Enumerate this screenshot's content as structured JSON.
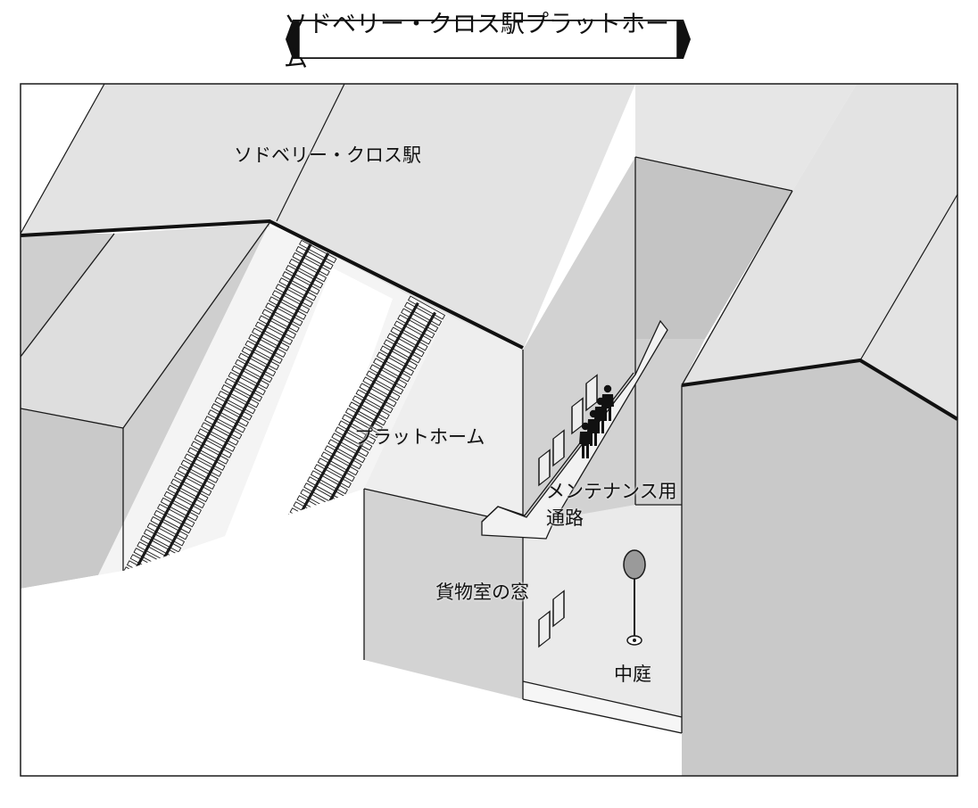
{
  "title": "ソドベリー・クロス駅プラットホーム",
  "labels": {
    "station": "ソドベリー・クロス駅",
    "platform": "プラットホーム",
    "maintenance_line1": "メンテナンス用",
    "maintenance_line2": "通路",
    "cargo_window": "貨物室の窓",
    "courtyard": "中庭"
  },
  "colors": {
    "roof": "#e4e4e4",
    "wall_light": "#d6d6d6",
    "wall_dark": "#c3c3c3",
    "platform_floor": "#f1f1f1",
    "ground": "#ffffff",
    "rail": "#1a1a1a",
    "sleeper": "#ffffff",
    "outline": "#1a1a1a"
  },
  "icons": {
    "people": "standing-person-icon",
    "sign": "round-sign-icon"
  }
}
